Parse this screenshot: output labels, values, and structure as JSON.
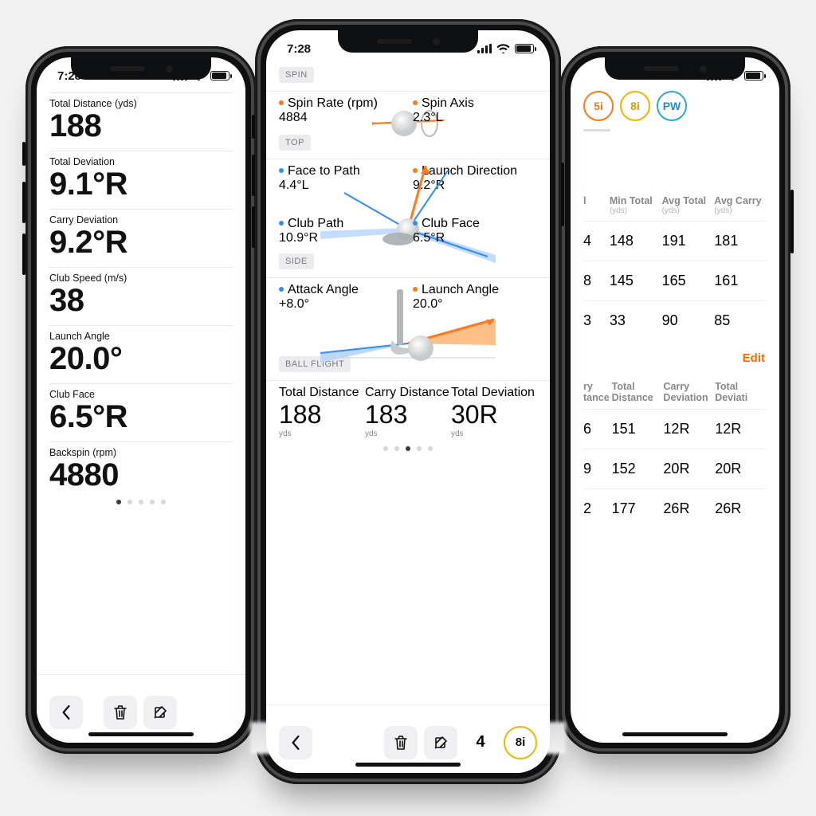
{
  "status": {
    "time": "7:28"
  },
  "left": {
    "metrics": [
      {
        "label": "Total Distance (yds)",
        "value": "188"
      },
      {
        "label": "Total Deviation",
        "value": "9.1°R"
      },
      {
        "label": "Carry Deviation",
        "value": "9.2°R"
      },
      {
        "label": "Club Speed (m/s)",
        "value": "38"
      },
      {
        "label": "Launch Angle",
        "value": "20.0°"
      },
      {
        "label": "Club Face",
        "value": "6.5°R"
      },
      {
        "label": "Backspin (rpm)",
        "value": "4880"
      }
    ]
  },
  "center": {
    "sections": {
      "spin": {
        "tag": "SPIN",
        "left": {
          "label": "Spin Rate (rpm)",
          "value": "4884"
        },
        "right": {
          "label": "Spin Axis",
          "value": "2.3°L"
        }
      },
      "top": {
        "tag": "TOP",
        "ul": {
          "label": "Face to Path",
          "value": "4.4°L"
        },
        "ur": {
          "label": "Launch Direction",
          "value": "9.2°R"
        },
        "ll": {
          "label": "Club Path",
          "value": "10.9°R"
        },
        "lr": {
          "label": "Club Face",
          "value": "6.5°R"
        }
      },
      "side": {
        "tag": "SIDE",
        "left": {
          "label": "Attack Angle",
          "value": "+8.0°"
        },
        "right": {
          "label": "Launch Angle",
          "value": "20.0°"
        }
      },
      "ballflight": {
        "tag": "BALL FLIGHT",
        "items": [
          {
            "label": "Total Distance",
            "value": "188",
            "unit": "yds"
          },
          {
            "label": "Carry Distance",
            "value": "183",
            "unit": "yds"
          },
          {
            "label": "Total Deviation",
            "value": "30R",
            "unit": "yds"
          }
        ]
      }
    },
    "toolbar": {
      "count": "4",
      "club": "8i"
    }
  },
  "right": {
    "clubs": {
      "c5i": "5i",
      "c8i": "8i",
      "cpw": "PW"
    },
    "table1": {
      "headers": [
        {
          "t": "l",
          "u": ""
        },
        {
          "t": "Min Total",
          "u": "(yds)"
        },
        {
          "t": "Avg Total",
          "u": "(yds)"
        },
        {
          "t": "Avg Carry",
          "u": "(yds)"
        }
      ],
      "rows": [
        [
          "4",
          "148",
          "191",
          "181"
        ],
        [
          "8",
          "145",
          "165",
          "161"
        ],
        [
          "3",
          "33",
          "90",
          "85"
        ]
      ]
    },
    "edit": "Edit",
    "table2": {
      "headers": [
        {
          "t": "ry tance",
          "u": ""
        },
        {
          "t": "Total Distance",
          "u": ""
        },
        {
          "t": "Carry Deviation",
          "u": ""
        },
        {
          "t": "Total Deviati",
          "u": ""
        }
      ],
      "rows": [
        [
          "6",
          "151",
          "12R",
          "12R"
        ],
        [
          "9",
          "152",
          "20R",
          "20R"
        ],
        [
          "2",
          "177",
          "26R",
          "26R"
        ]
      ]
    }
  }
}
